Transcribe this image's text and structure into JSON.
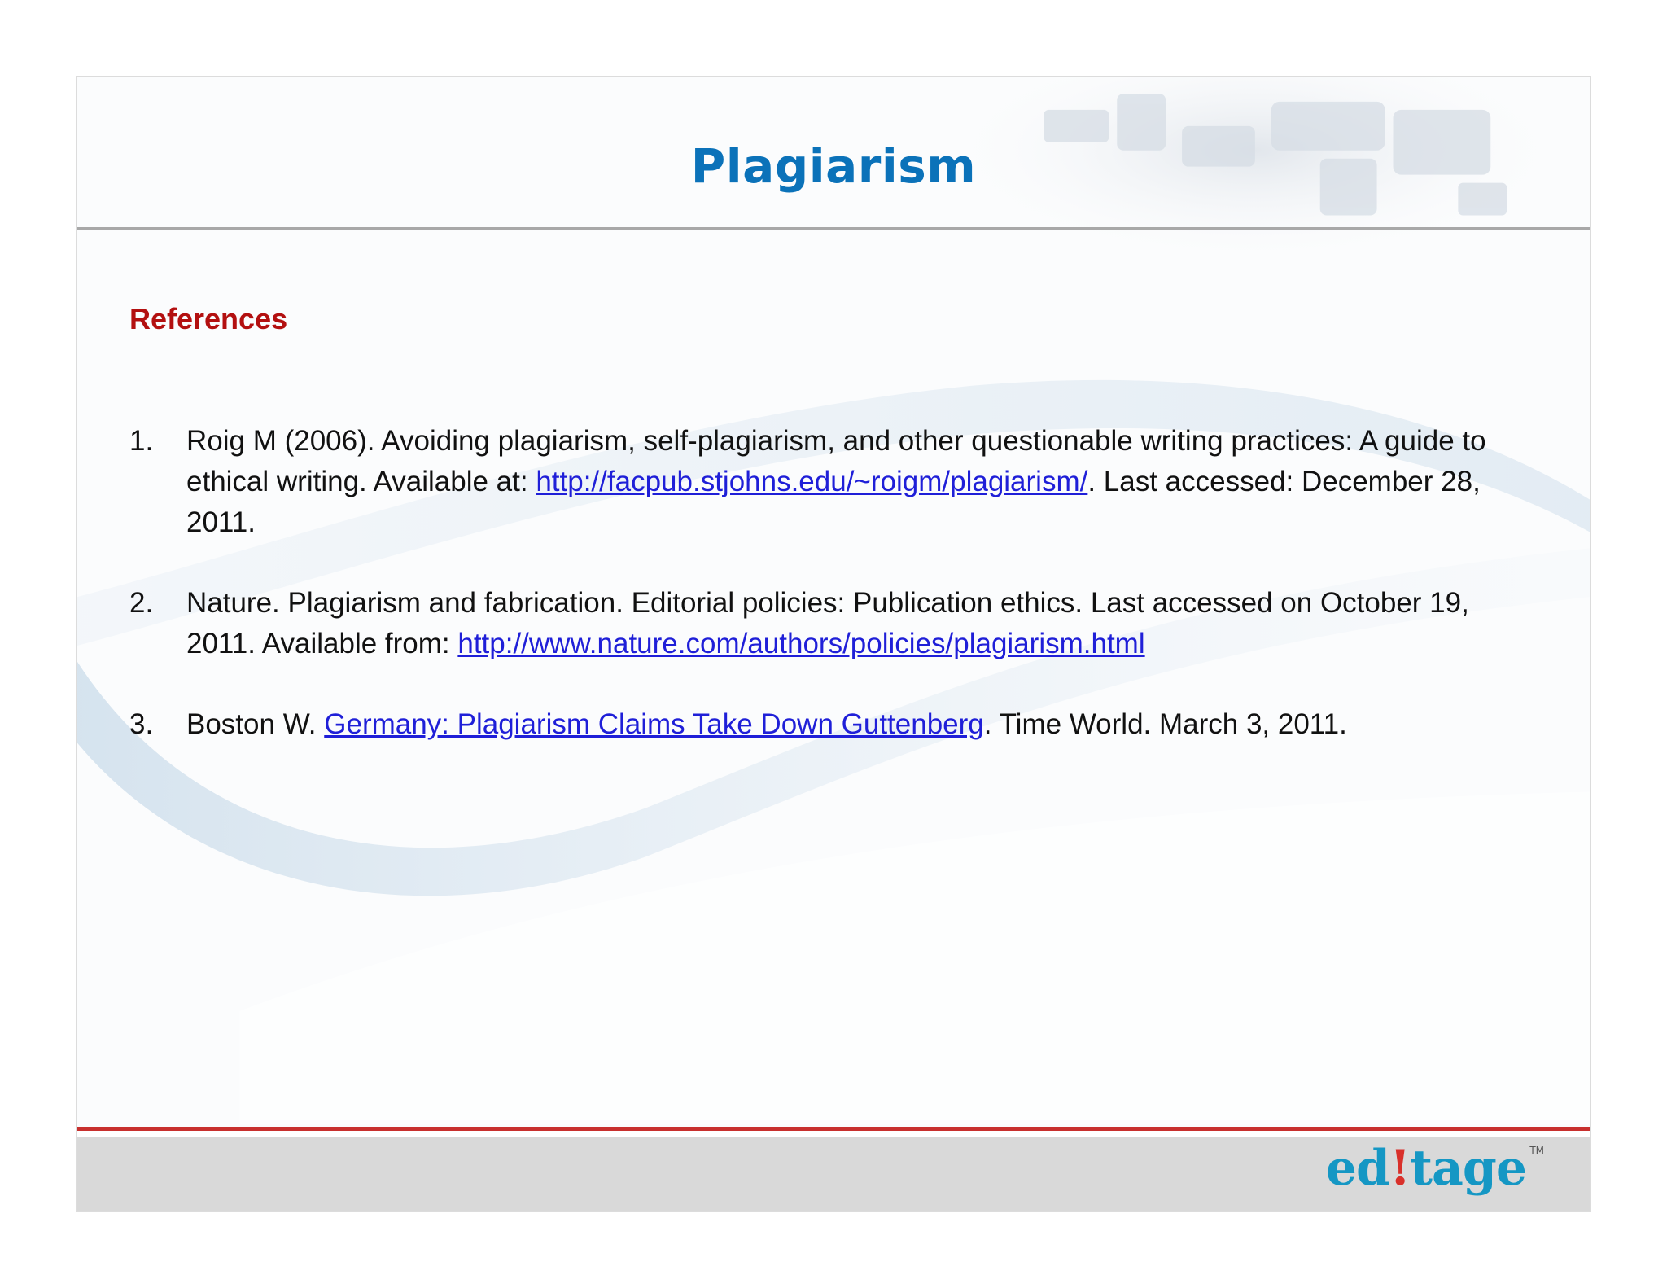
{
  "slide": {
    "title": "Plagiarism",
    "section_heading": "References"
  },
  "references": [
    {
      "number": "1.",
      "before": "Roig M (2006). Avoiding plagiarism, self-plagiarism, and other questionable writing practices: A guide to ethical writing. Available at: ",
      "link": "http://facpub.stjohns.edu/~roigm/plagiarism/",
      "after": ". Last accessed: December 28, 2011."
    },
    {
      "number": "2.",
      "before": "Nature. Plagiarism and fabrication. Editorial policies: Publication ethics. Last accessed on October 19, 2011. Available from: ",
      "link": "http://www.nature.com/authors/policies/plagiarism.html",
      "after": ""
    },
    {
      "number": "3.",
      "before": "Boston W. ",
      "link": "Germany: Plagiarism Claims Take Down Guttenberg",
      "after": ". Time World. March 3, 2011."
    }
  ],
  "logo": {
    "text": "editage",
    "trademark": "TM"
  },
  "colors": {
    "title": "#0b72b9",
    "heading": "#b31010",
    "link": "#1f1fd8",
    "footer_rule": "#c8302e",
    "footer_bar": "#d9d9d9",
    "logo": "#1597c4"
  }
}
